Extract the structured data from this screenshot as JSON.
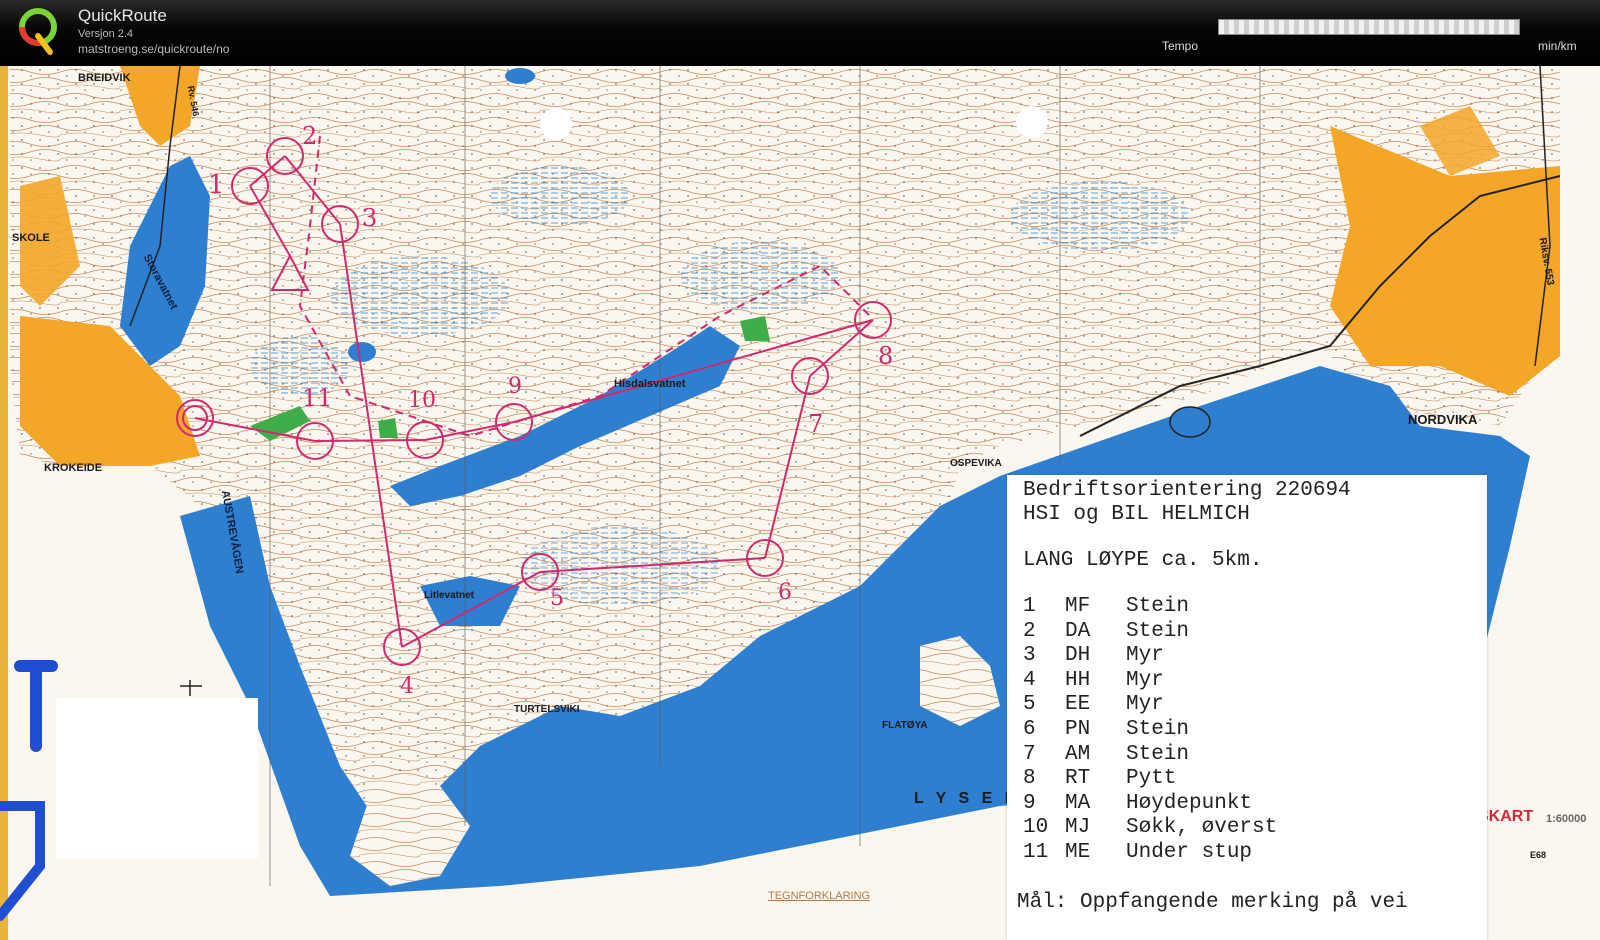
{
  "app": {
    "title": "QuickRoute",
    "version": "Versjon 2.4",
    "url": "matstroeng.se/quickroute/no"
  },
  "tempo": {
    "label": "Tempo",
    "unit": "min/km"
  },
  "map": {
    "place_labels": {
      "breidvik": "BREIDVIK",
      "skole": "SKOLE",
      "storavatnet": "Storavatnet",
      "krokeide": "KROKEIDE",
      "austrevagen": "AUSTREVÅGEN",
      "hisdalsvatnet": "Hisdalsvatnet",
      "litlevatnet": "Litlevatnet",
      "turtelsviki": "TURTELSVIKI",
      "flatoya": "FLATØYA",
      "ospevika": "OSPEVIKA",
      "nordvika": "NORDVIKA",
      "lysef": "L Y S E F",
      "riksv": "Riksv. 553",
      "skart": "SKART",
      "scale": "1:60000",
      "e68": "E68",
      "tegnforklaring": "TEGNFORKLARING",
      "rv546": "Rv. 546"
    },
    "course_numbers": {
      "c1": "1",
      "c2": "2",
      "c3": "3",
      "c4": "4",
      "c5": "5",
      "c6": "6",
      "c7": "7",
      "c8": "8",
      "c9": "9",
      "c10": "10",
      "c11": "11"
    }
  },
  "course_sheet": {
    "title": "Bedriftsorientering 220694",
    "club": "HSI og BIL HELMICH",
    "length": "LANG LØYPE ca. 5km.",
    "controls": [
      {
        "num": "1",
        "code": "MF",
        "desc": "Stein"
      },
      {
        "num": "2",
        "code": "DA",
        "desc": "Stein"
      },
      {
        "num": "3",
        "code": "DH",
        "desc": "Myr"
      },
      {
        "num": "4",
        "code": "HH",
        "desc": "Myr"
      },
      {
        "num": "5",
        "code": "EE",
        "desc": "Myr"
      },
      {
        "num": "6",
        "code": "PN",
        "desc": "Stein"
      },
      {
        "num": "7",
        "code": "AM",
        "desc": "Stein"
      },
      {
        "num": "8",
        "code": "RT",
        "desc": "Pytt"
      },
      {
        "num": "9",
        "code": "MA",
        "desc": "Høydepunkt"
      },
      {
        "num": "10",
        "code": "MJ",
        "desc": "Søkk, øverst"
      },
      {
        "num": "11",
        "code": "ME",
        "desc": "Under stup"
      }
    ],
    "finish": "Mål: Oppfangende merking på vei"
  },
  "colors": {
    "water": "#2f7fd0",
    "urban": "#f3a628",
    "course": "#d02a6e",
    "paper": "#fbf6ee",
    "contour": "#b57a4e"
  }
}
